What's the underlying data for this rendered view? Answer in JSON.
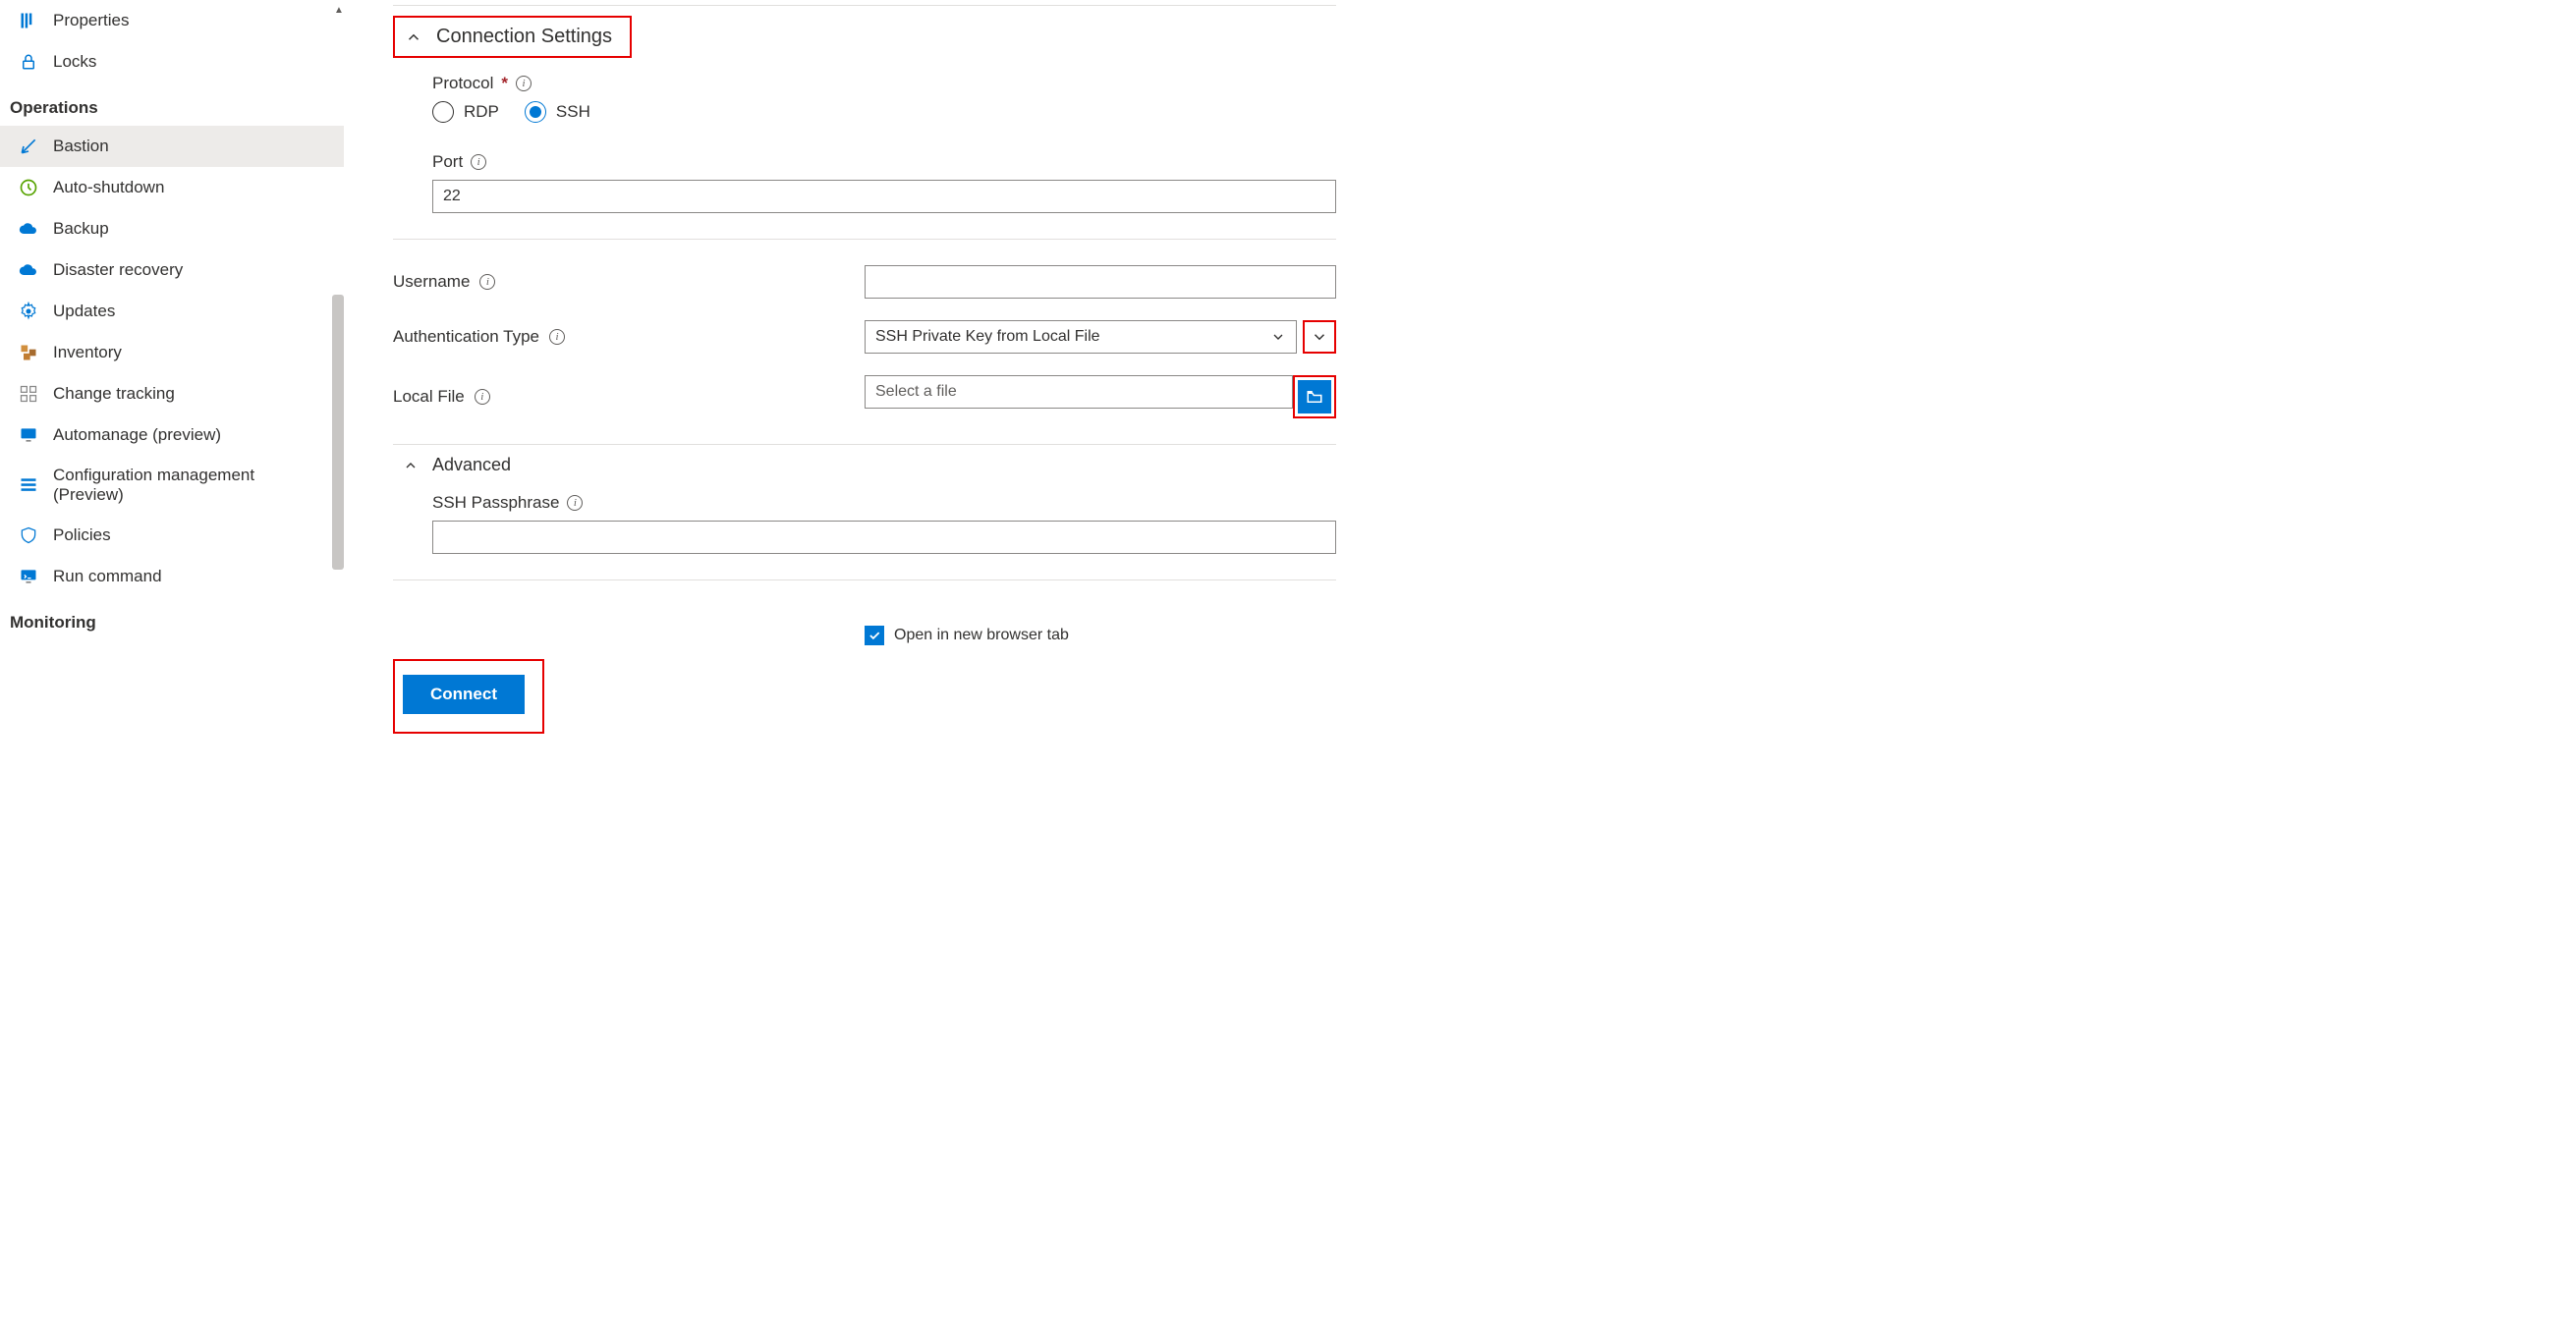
{
  "sidebar": {
    "items_top": [
      {
        "label": "Properties",
        "icon": "properties"
      },
      {
        "label": "Locks",
        "icon": "lock"
      }
    ],
    "group1_title": "Operations",
    "items_ops": [
      {
        "label": "Bastion",
        "icon": "bastion",
        "active": true
      },
      {
        "label": "Auto-shutdown",
        "icon": "clock"
      },
      {
        "label": "Backup",
        "icon": "cloud-blue"
      },
      {
        "label": "Disaster recovery",
        "icon": "cloud-blue"
      },
      {
        "label": "Updates",
        "icon": "gear-blue"
      },
      {
        "label": "Inventory",
        "icon": "boxes"
      },
      {
        "label": "Change tracking",
        "icon": "track"
      },
      {
        "label": "Automanage (preview)",
        "icon": "monitor"
      },
      {
        "label": "Configuration management (Preview)",
        "icon": "list"
      },
      {
        "label": "Policies",
        "icon": "shield"
      },
      {
        "label": "Run command",
        "icon": "console"
      }
    ],
    "group2_title": "Monitoring"
  },
  "main": {
    "section_title": "Connection Settings",
    "protocol_label": "Protocol",
    "protocol_options": {
      "rdp": "RDP",
      "ssh": "SSH"
    },
    "port_label": "Port",
    "port_value": "22",
    "username_label": "Username",
    "username_value": "",
    "auth_type_label": "Authentication Type",
    "auth_type_value": "SSH Private Key from Local File",
    "local_file_label": "Local File",
    "local_file_placeholder": "Select a file",
    "advanced_label": "Advanced",
    "passphrase_label": "SSH Passphrase",
    "passphrase_value": "",
    "open_new_tab_label": "Open in new browser tab",
    "connect_label": "Connect"
  }
}
